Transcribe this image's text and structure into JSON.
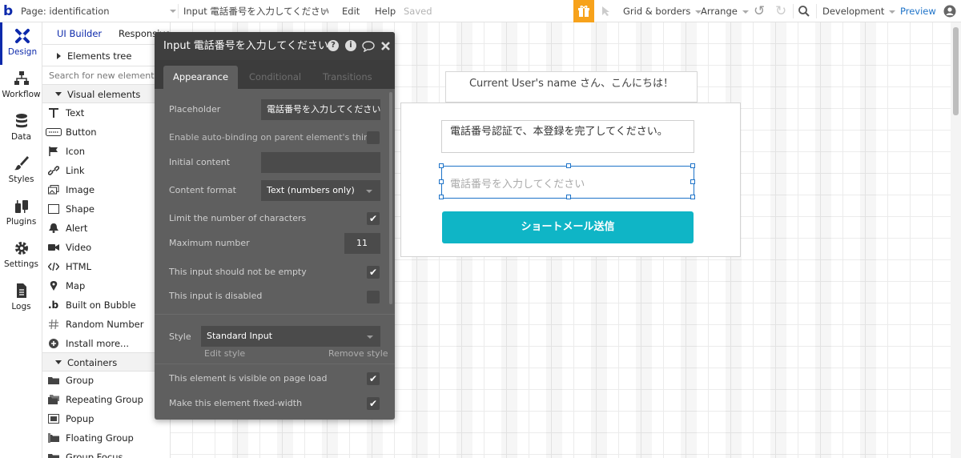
{
  "topbar": {
    "logo": "b",
    "page_selector": "Page: identification",
    "element_selector": "Input 電話番号を入力してください",
    "edit": "Edit",
    "help": "Help",
    "saved": "Saved",
    "grid_borders": "Grid & borders",
    "arrange": "Arrange",
    "environment": "Development",
    "preview": "Preview",
    "accent_gift": "#f7a21b",
    "accent_preview": "#1e73c8"
  },
  "nav": [
    {
      "label": "Design",
      "icon": "design-icon"
    },
    {
      "label": "Workflow",
      "icon": "workflow-icon"
    },
    {
      "label": "Data",
      "icon": "data-icon"
    },
    {
      "label": "Styles",
      "icon": "styles-icon"
    },
    {
      "label": "Plugins",
      "icon": "plugins-icon"
    },
    {
      "label": "Settings",
      "icon": "settings-icon"
    },
    {
      "label": "Logs",
      "icon": "logs-icon"
    }
  ],
  "panel": {
    "tab_ui_builder": "UI Builder",
    "tab_responsive": "Responsive",
    "elements_tree": "Elements tree",
    "search_placeholder": "Search for new elements...",
    "visual_section": "Visual elements",
    "visual_items": [
      {
        "label": "Text",
        "icon": "text-icon"
      },
      {
        "label": "Button",
        "icon": "button-icon"
      },
      {
        "label": "Icon",
        "icon": "flag-icon"
      },
      {
        "label": "Link",
        "icon": "link-icon"
      },
      {
        "label": "Image",
        "icon": "image-icon"
      },
      {
        "label": "Shape",
        "icon": "shape-icon"
      },
      {
        "label": "Alert",
        "icon": "bell-icon"
      },
      {
        "label": "Video",
        "icon": "video-icon"
      },
      {
        "label": "HTML",
        "icon": "code-icon"
      },
      {
        "label": "Map",
        "icon": "map-pin-icon"
      },
      {
        "label": "Built on Bubble",
        "icon": "bubble-logo-icon"
      },
      {
        "label": "Random Number",
        "icon": "hash-icon"
      },
      {
        "label": "Install more...",
        "icon": "plus-circle-icon"
      }
    ],
    "containers_section": "Containers",
    "container_items": [
      {
        "label": "Group",
        "icon": "folder-icon"
      },
      {
        "label": "Repeating Group",
        "icon": "folders-icon"
      },
      {
        "label": "Popup",
        "icon": "popup-icon"
      },
      {
        "label": "Floating Group",
        "icon": "floating-icon"
      },
      {
        "label": "Group Focus",
        "icon": "focus-icon"
      }
    ]
  },
  "property_editor": {
    "title": "Input 電話番号を入力してください",
    "tabs": [
      "Appearance",
      "Conditional",
      "Transitions"
    ],
    "placeholder_label": "Placeholder",
    "placeholder_value": "電話番号を入力してください",
    "autobinding_label": "Enable auto-binding on parent element's thing",
    "initial_content_label": "Initial content",
    "initial_content_value": "",
    "content_format_label": "Content format",
    "content_format_value": "Text (numbers only)",
    "limit_chars_label": "Limit the number of characters",
    "limit_chars_checked": true,
    "max_number_label": "Maximum number",
    "max_number_value": "11",
    "not_empty_label": "This input should not be empty",
    "not_empty_checked": true,
    "disabled_label": "This input is disabled",
    "disabled_checked": false,
    "style_label": "Style",
    "style_value": "Standard Input",
    "edit_style": "Edit style",
    "remove_style": "Remove style",
    "visible_label": "This element is visible on page load",
    "visible_checked": true,
    "fixed_width_label": "Make this element fixed-width",
    "fixed_width_checked": true,
    "checkmark": "✔"
  },
  "canvas": {
    "greeting": "Current User's name さん、こんにちは！",
    "instruction": "電話番号認証で、本登録を完了してください。",
    "phone_placeholder": "電話番号を入力してください",
    "send_button": "ショートメール送信",
    "button_color": "#0fb5c6"
  }
}
